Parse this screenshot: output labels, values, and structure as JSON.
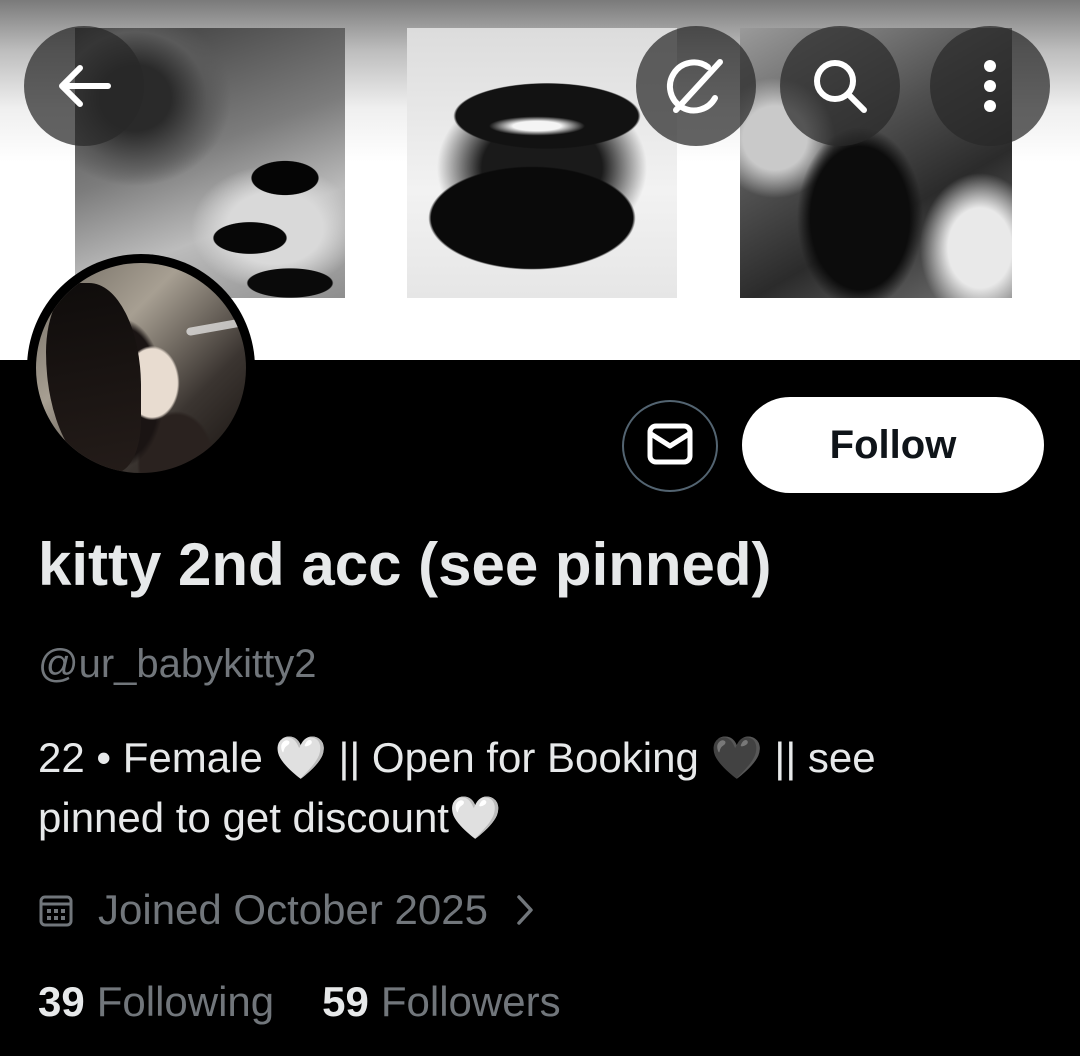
{
  "header": {
    "back_icon": "arrow-left-icon",
    "grok_icon": "grok-icon",
    "search_icon": "search-icon",
    "more_icon": "more-vertical-icon"
  },
  "profile": {
    "display_name": "kitty 2nd acc (see pinned)",
    "handle": "@ur_babykitty2",
    "bio_line1": "22 • Female 🤍 || Open for Booking 🖤 || see",
    "bio_line2": "pinned to get discount🤍",
    "joined": "Joined October 2025"
  },
  "actions": {
    "message_icon": "mail-icon",
    "follow_label": "Follow"
  },
  "stats": {
    "following_count": "39",
    "following_label": "Following",
    "followers_count": "59",
    "followers_label": "Followers"
  },
  "colors": {
    "background": "#000000",
    "primary_text": "#e7e9ea",
    "secondary_text": "#71767b",
    "button_fill": "#ffffff"
  }
}
